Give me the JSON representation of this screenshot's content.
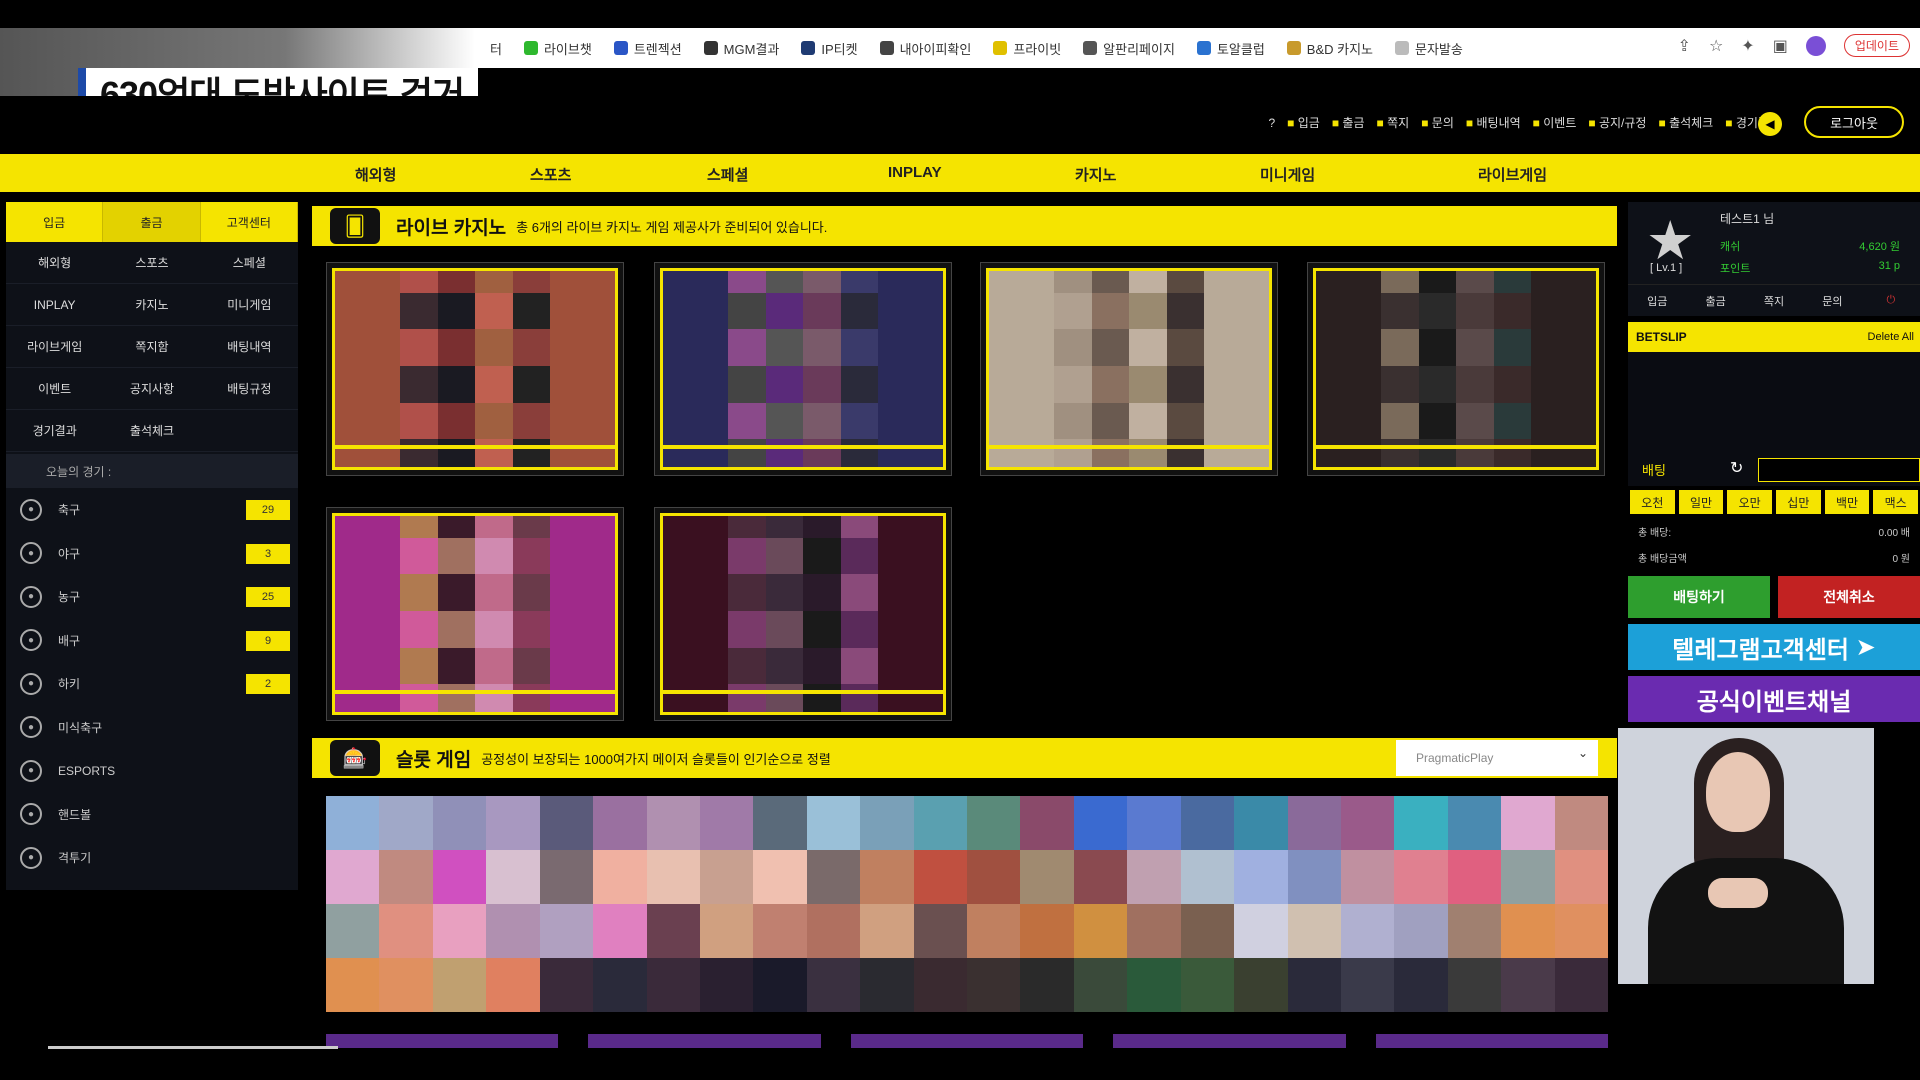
{
  "news_caption": {
    "title": "630억대 도박사이트 검거"
  },
  "browser": {
    "bookmarks": [
      {
        "label": "터",
        "color": "#ffffff"
      },
      {
        "label": "라이브챗",
        "color": "#2eb82e"
      },
      {
        "label": "트렌젝션",
        "color": "#2a56c6"
      },
      {
        "label": "MGM결과",
        "color": "#333333"
      },
      {
        "label": "IP티켓",
        "color": "#1f3b73"
      },
      {
        "label": "내아이피확인",
        "color": "#444444"
      },
      {
        "label": "프라이빗",
        "color": "#e0c000"
      },
      {
        "label": "알판리페이지",
        "color": "#555555"
      },
      {
        "label": "토알클럽",
        "color": "#2a72d0"
      },
      {
        "label": "B&D 카지노",
        "color": "#c89a2c"
      },
      {
        "label": "문자발송",
        "color": "#bbbbbb"
      }
    ],
    "update_label": "업데이트"
  },
  "header": {
    "util_links": [
      "입금",
      "출금",
      "쪽지",
      "문의",
      "배팅내역",
      "이벤트",
      "공지/규정",
      "출석체크",
      "경기결과"
    ],
    "logout_label": "로그아웃"
  },
  "main_nav": [
    "해외형",
    "스포츠",
    "스페셜",
    "INPLAY",
    "카지노",
    "미니게임",
    "라이브게임"
  ],
  "sidebar": {
    "top_buttons": [
      "입금",
      "출금",
      "고객센터"
    ],
    "menu": [
      "해외형",
      "스포츠",
      "스페셜",
      "INPLAY",
      "카지노",
      "미니게임",
      "라이브게임",
      "쪽지함",
      "배팅내역",
      "이벤트",
      "공지사항",
      "배팅규정",
      "경기결과",
      "출석체크",
      ""
    ],
    "today_label": "오늘의 경기 :",
    "sports": [
      {
        "name": "축구",
        "count": "29",
        "icon": "soccer-icon"
      },
      {
        "name": "야구",
        "count": "3",
        "icon": "baseball-icon"
      },
      {
        "name": "농구",
        "count": "25",
        "icon": "basketball-icon"
      },
      {
        "name": "배구",
        "count": "9",
        "icon": "volleyball-icon"
      },
      {
        "name": "하키",
        "count": "2",
        "icon": "hockey-icon"
      },
      {
        "name": "미식축구",
        "count": "",
        "icon": "football-icon"
      },
      {
        "name": "ESPORTS",
        "count": "",
        "icon": "esports-icon"
      },
      {
        "name": "핸드볼",
        "count": "",
        "icon": "handball-icon"
      },
      {
        "name": "격투기",
        "count": "",
        "icon": "boxing-icon"
      }
    ]
  },
  "live_casino": {
    "title": "라이브 카지노",
    "subtitle": "총 6개의 라이브 카지노 게임 제공사가 준비되어 있습니다."
  },
  "slot_game": {
    "title": "슬롯 게임",
    "subtitle": "공정성이 보장되는 1000여가지 메이저 슬롯들이 인기순으로 정렬",
    "provider_selected": "PragmaticPlay"
  },
  "user_panel": {
    "name": "테스트1 님",
    "cash_label": "캐쉬",
    "cash_value": "4,620 원",
    "point_label": "포인트",
    "point_value": "31 p",
    "level": "[ Lv.1 ]",
    "quick": [
      "입금",
      "출금",
      "쪽지",
      "문의"
    ]
  },
  "betslip": {
    "title": "BETSLIP",
    "delete_all": "Delete All",
    "bet_label": "배팅",
    "amounts": [
      "오천",
      "일만",
      "오만",
      "십만",
      "백만",
      "맥스"
    ],
    "total_odds_label": "총 배당:",
    "total_odds_value": "0.00 배",
    "total_win_label": "총 배당금액",
    "total_win_value": "0 원",
    "bet_button": "배팅하기",
    "cancel_button": "전체취소"
  },
  "banners": {
    "telegram": "텔레그램고객센터",
    "event": "공식이벤트채널"
  },
  "colors": {
    "accent": "#f5e400",
    "bg": "#000000",
    "panel": "#0e1118",
    "bet_green": "#2e9e2e",
    "cancel_red": "#c22222",
    "telegram_blue": "#1ca0d8"
  }
}
